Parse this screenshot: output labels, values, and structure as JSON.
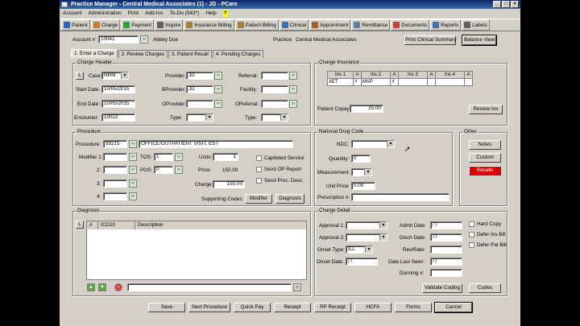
{
  "window": {
    "title": "Practice Manager - Central Medical Associates (1) - JD - PCare"
  },
  "menu": [
    "Account",
    "Administration",
    "Print",
    "Add-Ins",
    "To-Do (543*)",
    "Help"
  ],
  "menu_flag": "?",
  "toolbar": [
    {
      "label": "Patient",
      "icon": "person-icon",
      "color": "#3060c0"
    },
    {
      "label": "Charge",
      "icon": "tag-icon",
      "color": "#c08030"
    },
    {
      "label": "Payment",
      "icon": "dollar-icon",
      "color": "#30a040"
    },
    {
      "label": "Inquire",
      "icon": "magnify-icon",
      "color": "#606060"
    },
    {
      "label": "Insurance Billing",
      "icon": "handshake-icon",
      "color": "#a08040"
    },
    {
      "label": "Patient Billing",
      "icon": "handshake-icon",
      "color": "#a08040"
    },
    {
      "label": "Clinical",
      "icon": "stethoscope-icon",
      "color": "#4070b0"
    },
    {
      "label": "Appointment",
      "icon": "calendar-icon",
      "color": "#a06030"
    },
    {
      "label": "Remittance",
      "icon": "envelope-icon",
      "color": "#6080a0"
    },
    {
      "label": "Documents",
      "icon": "document-icon",
      "color": "#c04040"
    },
    {
      "label": "Reports",
      "icon": "report-icon",
      "color": "#4070b0"
    },
    {
      "label": "Labels",
      "icon": "label-icon",
      "color": "#606060"
    }
  ],
  "account": {
    "label": "Account #:",
    "number": "10041",
    "name": "Abbey Doe",
    "practice_label": "Practice:",
    "practice": "Central Medical Associates",
    "print_summary": "Print Clinical Summary",
    "balance_view": "Balance View"
  },
  "tabs": [
    "1. Enter a Charge",
    "2. Review Charges",
    "3. Patient Recall",
    "4. Pending Charges"
  ],
  "charge_header": {
    "title": "Charge Header",
    "l_button": "L",
    "case_label": "Case:",
    "case_value": "NRM",
    "start_label": "Start Date:",
    "start_value": "10/05/2015",
    "end_label": "End Date:",
    "end_value": "10/05/2015",
    "encounter_label": "Encounter:",
    "encounter_value": "10022",
    "provider_label": "Provider:",
    "provider_value": "JD",
    "bprovider_label": "BProvider:",
    "bprovider_value": "JD",
    "oprovider_label": "OProvider:",
    "type1_label": "Type:",
    "referral_label": "Referral:",
    "facility_label": "Facility:",
    "oreferral_label": "OReferral:",
    "type2_label": "Type:"
  },
  "charge_insurance": {
    "title": "Charge Insurance",
    "headers": [
      "Ins 1",
      "A",
      "Ins 2",
      "A",
      "Ins 3",
      "A",
      "Ins 4",
      "A"
    ],
    "values": [
      "AET",
      "Y",
      "MVP",
      "Y",
      "",
      "",
      "",
      ""
    ],
    "copay_label": "Patient Copay:",
    "copay_value": "25.00",
    "review_button": "Review Ins"
  },
  "procedure": {
    "title": "Procedure",
    "proc_label": "Procedure:",
    "proc_code": "99215",
    "proc_desc": "OFFICE/OUTPATIENT VISIT, EST",
    "modifier_label": "Modifier 1:",
    "mod2": "2:",
    "mod3": "3:",
    "mod4": "4:",
    "tos_label": "TOS:",
    "tos_value": "1",
    "pos_label": "POS:",
    "pos_value": "0",
    "units_label": "Units:",
    "units_value": "1",
    "price_label": "Price:",
    "price_value": "150.00",
    "charge_label": "Charge:",
    "charge_value": "150.00",
    "capitated": "Capitated Service",
    "send_op": "Send OP Report",
    "send_proc": "Send Proc. Desc.",
    "supporting": "Supporting Codes:",
    "modifier_button": "Modifier",
    "diagnosis_button": "Diagnosis"
  },
  "ndc": {
    "title": "National Drug Code",
    "ndc_label": "NDC:",
    "quantity_label": "Quantity:",
    "quantity_value": "0",
    "measurement_label": "Measurement:",
    "unit_price_label": "Unit Price:",
    "unit_price_value": "0.00",
    "prescription_label": "Prescription #:"
  },
  "other": {
    "title": "Other",
    "notes": "Notes",
    "custom": "Custom",
    "recalls": "Recalls",
    "recalls_color": "#e00000"
  },
  "diagnosis": {
    "title": "Diagnosis",
    "l_button": "L",
    "col_num": "#",
    "col_icd": "ICD10",
    "col_desc": "Description"
  },
  "charge_detail": {
    "title": "Charge Detail",
    "approval1": "Approval 1:",
    "approval2": "Approval 2:",
    "onset_type": "Onset Type:",
    "onset_type_value": "ILL",
    "onset_date": "Onset Date:",
    "onset_date_value": "/ /",
    "admit": "Admit Date:",
    "admit_value": "/ /",
    "disch": "Disch Date:",
    "disch_value": "/ /",
    "rev_rate": "Rev/Rate:",
    "date_last_seen": "Date Last Seen:",
    "date_last_seen_value": "/ /",
    "dunning": "Dunning #:",
    "hard_copy": "Hard Copy",
    "defer_ins": "Defer Ins Bill",
    "defer_pat": "Defer Pat Bill",
    "validate": "Validate Coding",
    "codes": "Codes"
  },
  "bottom": [
    "Save",
    "Next Procedure",
    "Quick Pay",
    "Receipt",
    "RP Receipt",
    "HCFA",
    "Forms",
    "Cancel"
  ]
}
